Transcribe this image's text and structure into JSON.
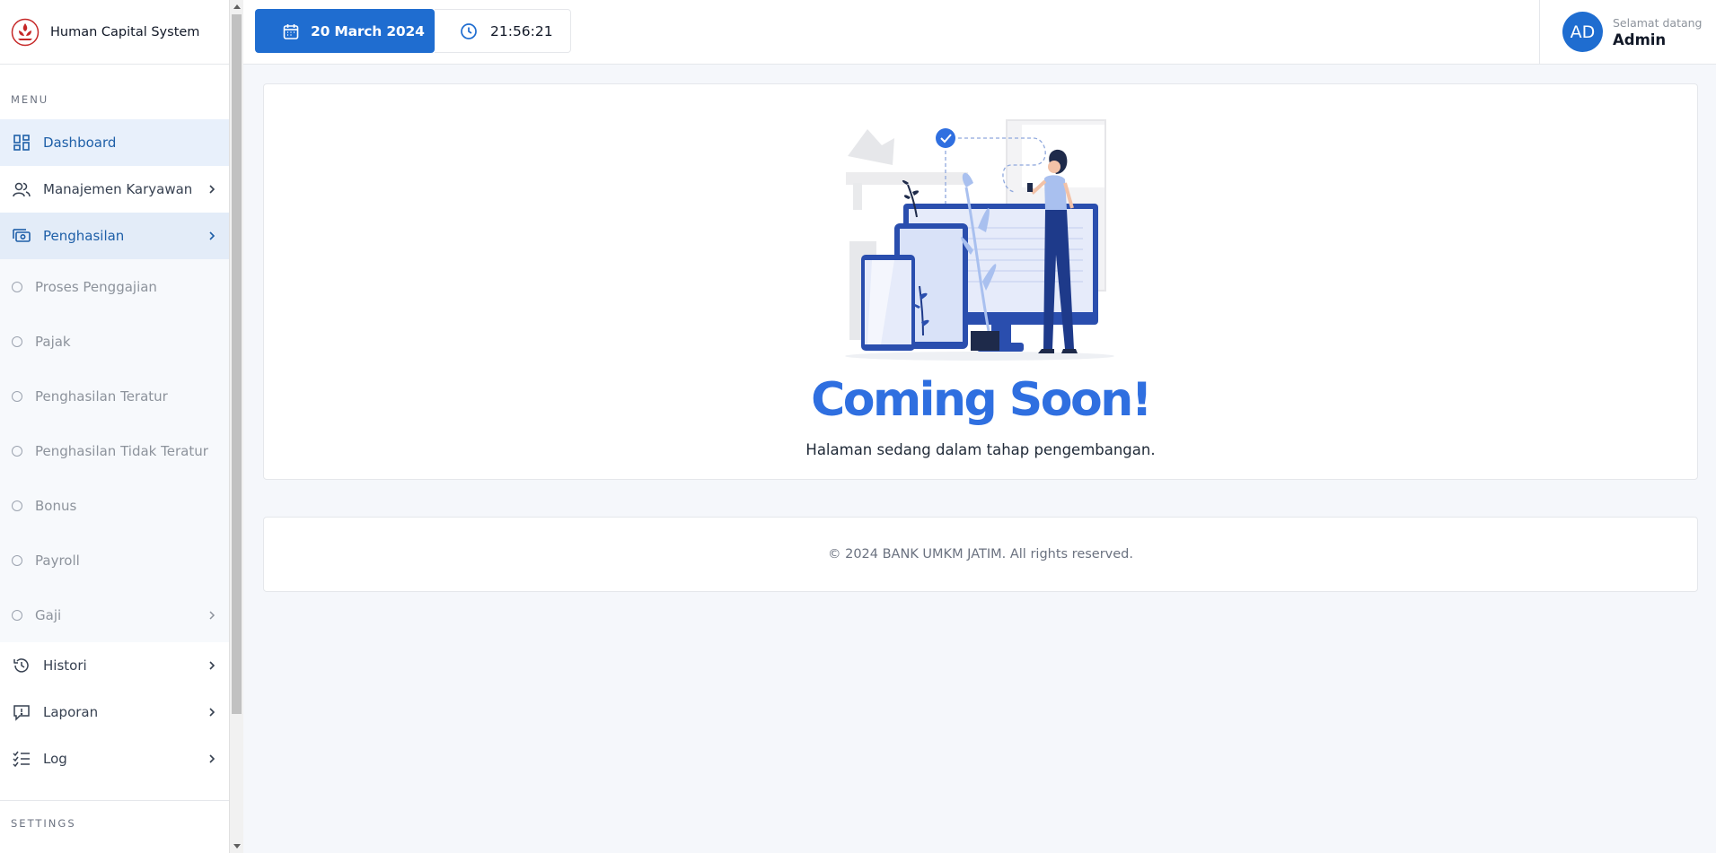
{
  "app": {
    "brand_name": "Human Capital System"
  },
  "sidebar": {
    "menu_title": "MENU",
    "items": [
      {
        "label": "Dashboard",
        "icon": "dashboard-grid-icon"
      },
      {
        "label": "Manajemen Karyawan",
        "icon": "users-icon"
      },
      {
        "label": "Penghasilan",
        "icon": "cash-icon"
      }
    ],
    "sub_items": [
      {
        "label": "Proses Penggajian"
      },
      {
        "label": "Pajak"
      },
      {
        "label": "Penghasilan Teratur"
      },
      {
        "label": "Penghasilan Tidak Teratur"
      },
      {
        "label": "Bonus"
      },
      {
        "label": "Payroll"
      },
      {
        "label": "Gaji"
      }
    ],
    "items_after": [
      {
        "label": "Histori",
        "icon": "history-icon"
      },
      {
        "label": "Laporan",
        "icon": "report-icon"
      },
      {
        "label": "Log",
        "icon": "checklist-icon"
      }
    ],
    "settings_title": "SETTINGS"
  },
  "topbar": {
    "date": "20 March 2024",
    "time": "21:56:21",
    "greeting": "Selamat datang",
    "user_name": "Admin",
    "avatar_initials": "AD"
  },
  "main": {
    "heading": "Coming Soon!",
    "description": "Halaman sedang dalam tahap pengembangan."
  },
  "footer": {
    "text": "© 2024 BANK UMKM JATIM. All rights reserved."
  },
  "colors": {
    "primary": "#1f6dd0",
    "heading": "#2f6fe0",
    "active_bg": "#e8f0fb",
    "brand_red": "#c62828"
  }
}
